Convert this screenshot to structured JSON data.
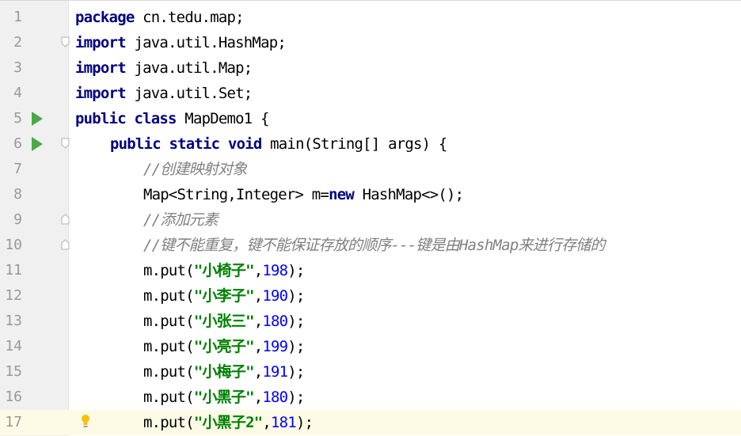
{
  "editor": {
    "lines": [
      {
        "n": "1",
        "parts": [
          {
            "t": "package",
            "c": "kw"
          },
          {
            "t": " cn.tedu.map;",
            "c": ""
          }
        ]
      },
      {
        "n": "2",
        "parts": [
          {
            "t": "import",
            "c": "kw"
          },
          {
            "t": " java.util.HashMap;",
            "c": ""
          }
        ]
      },
      {
        "n": "3",
        "parts": [
          {
            "t": "import",
            "c": "kw"
          },
          {
            "t": " java.util.Map;",
            "c": ""
          }
        ]
      },
      {
        "n": "4",
        "parts": [
          {
            "t": "import",
            "c": "kw"
          },
          {
            "t": " java.util.Set;",
            "c": ""
          }
        ]
      },
      {
        "n": "5",
        "parts": [
          {
            "t": "public class",
            "c": "kw"
          },
          {
            "t": " MapDemo1 {",
            "c": ""
          }
        ]
      },
      {
        "n": "6",
        "parts": [
          {
            "t": "public static void",
            "c": "kw"
          },
          {
            "t": " main(String[] args) {",
            "c": ""
          }
        ]
      },
      {
        "n": "7",
        "parts": [
          {
            "t": "//创建映射对象",
            "c": "cm"
          }
        ]
      },
      {
        "n": "8",
        "parts": [
          {
            "t": "Map<String,Integer> m=",
            "c": ""
          },
          {
            "t": "new",
            "c": "kw"
          },
          {
            "t": " HashMap<>();",
            "c": ""
          }
        ]
      },
      {
        "n": "9",
        "parts": [
          {
            "t": "//添加元素",
            "c": "cm"
          }
        ]
      },
      {
        "n": "10",
        "parts": [
          {
            "t": "//键不能重复，键不能保证存放的顺序---键是由HashMap来进行存储的",
            "c": "cm"
          }
        ]
      },
      {
        "n": "11",
        "parts": [
          {
            "t": "m.put(",
            "c": ""
          },
          {
            "t": "\"小椅子\"",
            "c": "str"
          },
          {
            "t": ",",
            "c": ""
          },
          {
            "t": "198",
            "c": "num"
          },
          {
            "t": ");",
            "c": ""
          }
        ]
      },
      {
        "n": "12",
        "parts": [
          {
            "t": "m.put(",
            "c": ""
          },
          {
            "t": "\"小李子\"",
            "c": "str"
          },
          {
            "t": ",",
            "c": ""
          },
          {
            "t": "190",
            "c": "num"
          },
          {
            "t": ");",
            "c": ""
          }
        ]
      },
      {
        "n": "13",
        "parts": [
          {
            "t": "m.put(",
            "c": ""
          },
          {
            "t": "\"小张三\"",
            "c": "str"
          },
          {
            "t": ",",
            "c": ""
          },
          {
            "t": "180",
            "c": "num"
          },
          {
            "t": ");",
            "c": ""
          }
        ]
      },
      {
        "n": "14",
        "parts": [
          {
            "t": "m.put(",
            "c": ""
          },
          {
            "t": "\"小亮子\"",
            "c": "str"
          },
          {
            "t": ",",
            "c": ""
          },
          {
            "t": "199",
            "c": "num"
          },
          {
            "t": ");",
            "c": ""
          }
        ]
      },
      {
        "n": "15",
        "parts": [
          {
            "t": "m.put(",
            "c": ""
          },
          {
            "t": "\"小梅子\"",
            "c": "str"
          },
          {
            "t": ",",
            "c": ""
          },
          {
            "t": "191",
            "c": "num"
          },
          {
            "t": ");",
            "c": ""
          }
        ]
      },
      {
        "n": "16",
        "parts": [
          {
            "t": "m.put(",
            "c": ""
          },
          {
            "t": "\"小黑子\"",
            "c": "str"
          },
          {
            "t": ",",
            "c": ""
          },
          {
            "t": "180",
            "c": "num"
          },
          {
            "t": ");",
            "c": ""
          }
        ]
      },
      {
        "n": "17",
        "parts": [
          {
            "t": "m.put(",
            "c": ""
          },
          {
            "t": "\"小黑子2\"",
            "c": "str"
          },
          {
            "t": ",",
            "c": ""
          },
          {
            "t": "181",
            "c": "num"
          },
          {
            "t": ");",
            "c": ""
          }
        ]
      }
    ],
    "run_markers": [
      "5",
      "6"
    ],
    "fold_markers": [
      "2",
      "6",
      "9",
      "10"
    ],
    "current_line": "17",
    "intention_bulb_line": "17",
    "colors": {
      "keyword": "#000080",
      "comment": "#808080",
      "string": "#008000",
      "number": "#0000ff",
      "run_icon": "#4aa94b",
      "current_line_bg": "#fdfbe6",
      "gutter_bg": "#f0f0f0"
    },
    "icons": {
      "run": "run-gutter-icon",
      "fold": "fold-gutter-icon",
      "bulb": "intention-bulb-icon"
    }
  }
}
